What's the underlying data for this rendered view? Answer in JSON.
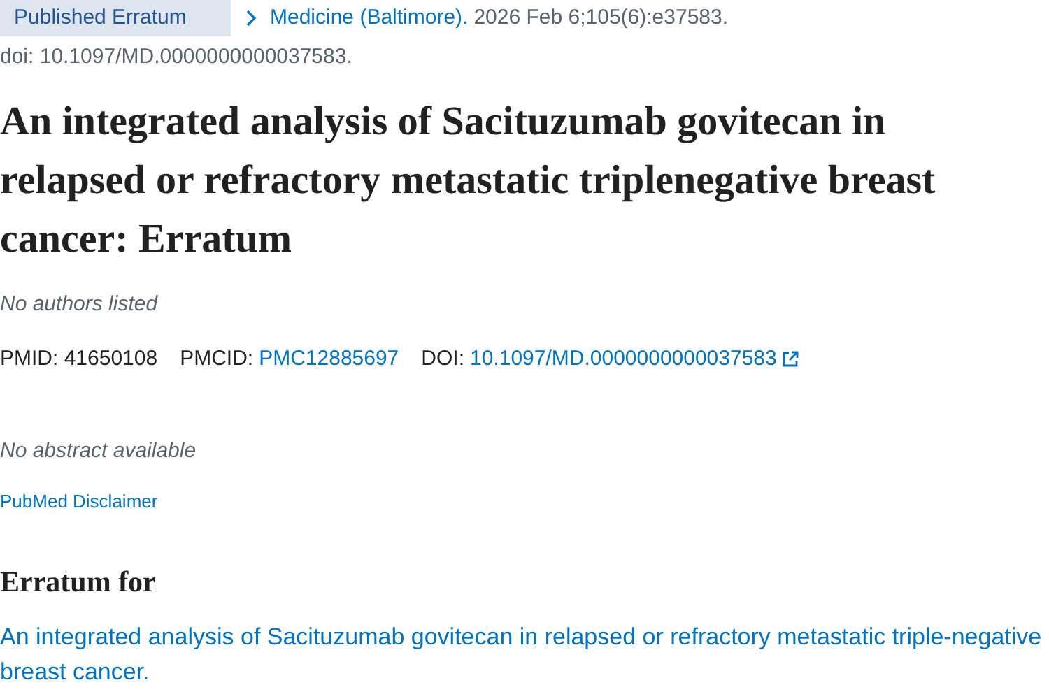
{
  "article_type": "Published Erratum",
  "citation": {
    "journal": "Medicine (Baltimore).",
    "date": "2026 Feb 6;105(6):e37583.",
    "doi": "doi: 10.1097/MD.0000000000037583."
  },
  "title": "An integrated analysis of Sacituzumab govitecan in relapsed or refractory metastatic triplenegative breast cancer: Erratum",
  "authors": "No authors listed",
  "identifiers": {
    "pmid_label": "PMID:",
    "pmid": "41650108",
    "pmcid_label": "PMCID:",
    "pmcid": "PMC12885697",
    "doi_label": "DOI:",
    "doi": "10.1097/MD.0000000000037583"
  },
  "abstract": "No abstract available",
  "disclaimer_link": "PubMed Disclaimer",
  "erratum_for": {
    "heading": "Erratum for",
    "link": "An integrated analysis of Sacituzumab govitecan in relapsed or refractory metastatic triple-negative breast cancer."
  }
}
